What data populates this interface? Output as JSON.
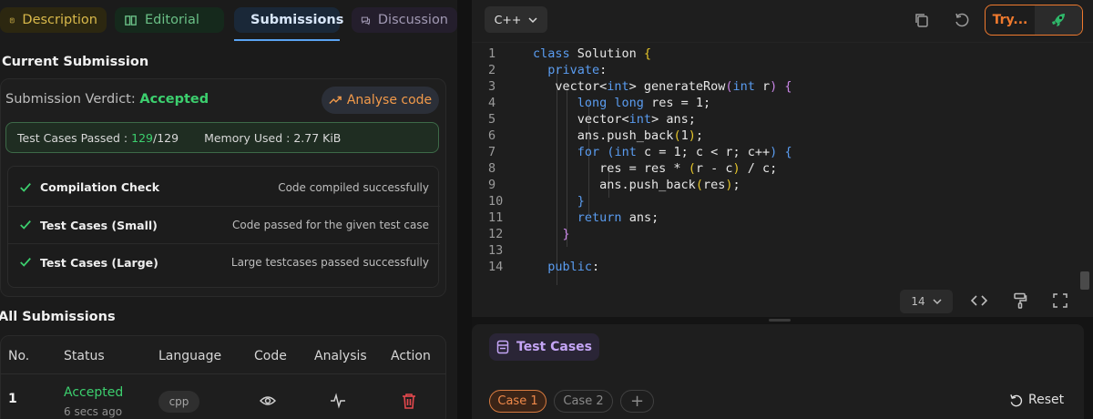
{
  "tabs": {
    "description": "Description",
    "editorial": "Editorial",
    "submissions": "Submissions",
    "discussion": "Discussion"
  },
  "current": {
    "title": "Current Submission",
    "verdict_label": "Submission Verdict:",
    "verdict_value": "Accepted",
    "analyse_label": "Analyse code",
    "tests_label": "Test Cases Passed :",
    "tests_passed": "129",
    "tests_total": "/129",
    "memory_label": "Memory Used : 2.77 KiB",
    "checks": [
      {
        "name": "Compilation Check",
        "detail": "Code compiled successfully"
      },
      {
        "name": "Test Cases (Small)",
        "detail": "Code passed for the given test case"
      },
      {
        "name": "Test Cases (Large)",
        "detail": "Large testcases passed successfully"
      }
    ]
  },
  "all": {
    "title": "All Submissions",
    "headers": [
      "No.",
      "Status",
      "Language",
      "Code",
      "Analysis",
      "Action"
    ],
    "rows": [
      {
        "no": "1",
        "status": "Accepted",
        "time": "6 secs ago",
        "language": "cpp"
      }
    ]
  },
  "editor": {
    "language": "C++",
    "try_label": "Try...",
    "font_size": "14",
    "line_numbers": [
      "1",
      "2",
      "3",
      "4",
      "5",
      "6",
      "7",
      "8",
      "9",
      "10",
      "11",
      "12",
      "13",
      "14"
    ]
  },
  "testcases": {
    "tab_label": "Test Cases",
    "cases": [
      "Case 1",
      "Case 2"
    ],
    "add": "+",
    "reset": "Reset"
  },
  "colors": {
    "accent_orange": "#f07a2e",
    "accepted_green": "#3ccf6e",
    "submissions_blue": "#5aa3f2"
  }
}
